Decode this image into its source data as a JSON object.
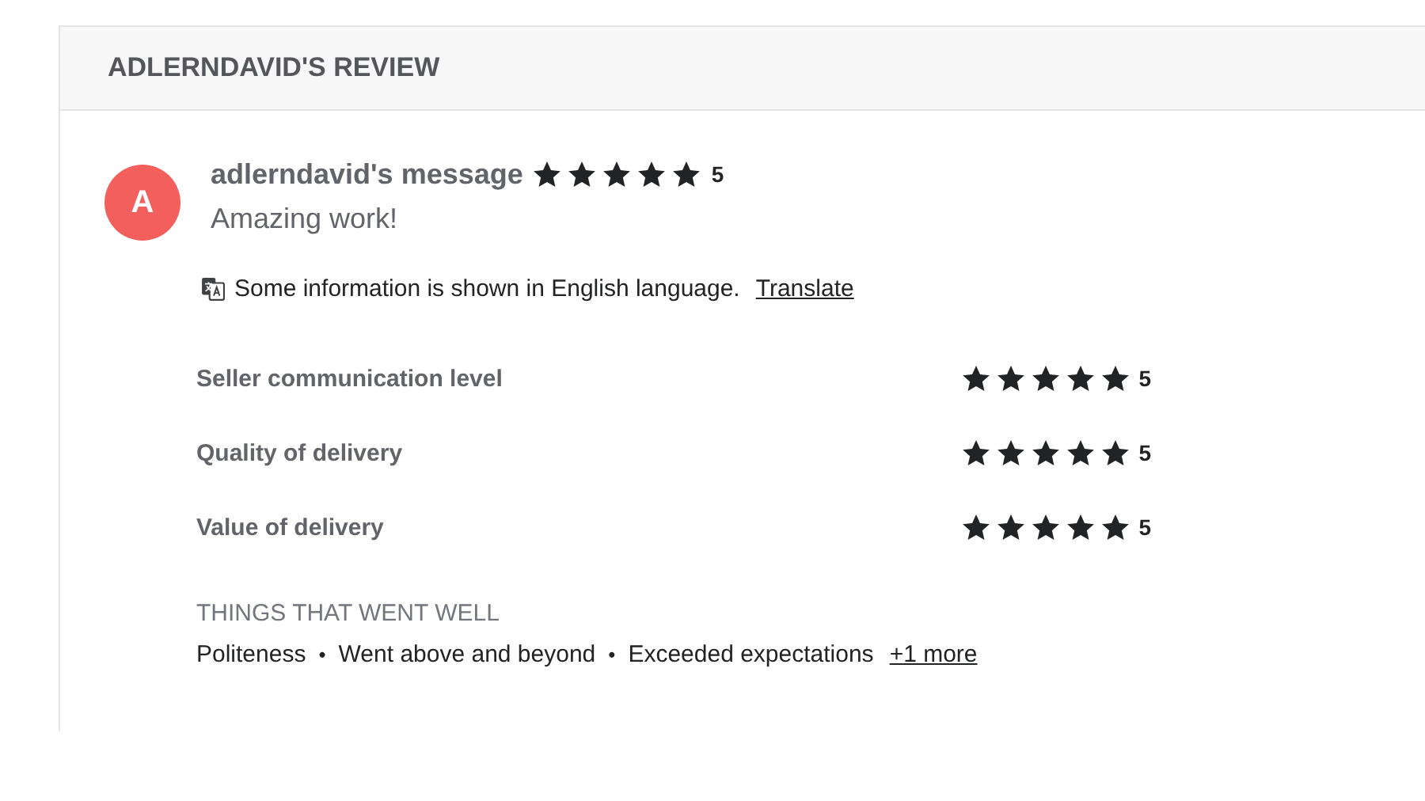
{
  "card": {
    "title": "ADLERNDAVID'S REVIEW"
  },
  "review": {
    "avatar_letter": "A",
    "author": "adlerndavid's message",
    "stars": 5,
    "score": "5",
    "message": "Amazing work!"
  },
  "translation_notice": {
    "text": "Some information is shown in English language.",
    "link": "Translate"
  },
  "ratings": [
    {
      "label": "Seller communication level",
      "stars": 5,
      "score": "5"
    },
    {
      "label": "Quality of delivery",
      "stars": 5,
      "score": "5"
    },
    {
      "label": "Value of delivery",
      "stars": 5,
      "score": "5"
    }
  ],
  "things_went_well": {
    "heading": "THINGS THAT WENT WELL",
    "separator": "•",
    "tags": [
      "Politeness",
      "Went above and beyond",
      "Exceeded expectations"
    ],
    "more_link": "+1 more"
  }
}
